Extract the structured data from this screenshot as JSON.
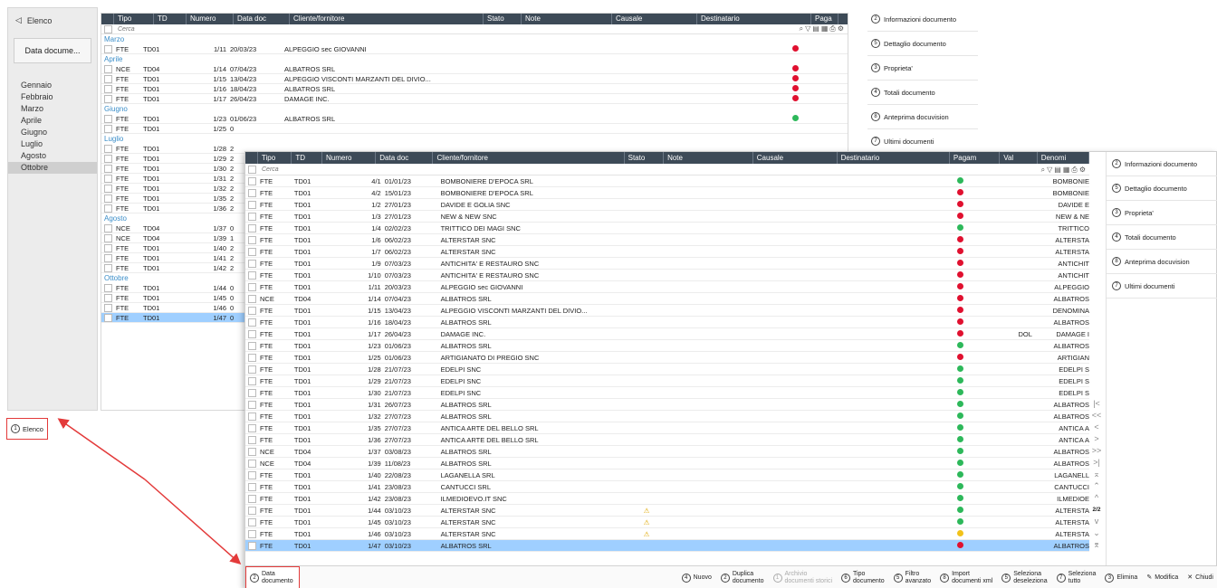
{
  "back": {
    "sidebar": {
      "elenco_label": "Elenco",
      "data_doc_button": "Data docume...",
      "months": [
        "Gennaio",
        "Febbraio",
        "Marzo",
        "Aprile",
        "Giugno",
        "Luglio",
        "Agosto",
        "Ottobre"
      ],
      "selected_month": "Ottobre"
    },
    "columns": [
      "Tipo",
      "TD",
      "Numero",
      "Data doc",
      "Cliente/fornitore",
      "Stato",
      "Note",
      "Causale",
      "Destinatario",
      "Paga"
    ],
    "search_placeholder": "Cerca",
    "groups": [
      {
        "name": "Marzo",
        "rows": [
          {
            "tipo": "FTE",
            "td": "TD01",
            "num": "1/11",
            "data": "20/03/23",
            "cliente": "ALPEGGIO sec GIOVANNI",
            "pag": "red"
          }
        ]
      },
      {
        "name": "Aprile",
        "rows": [
          {
            "tipo": "NCE",
            "td": "TD04",
            "num": "1/14",
            "data": "07/04/23",
            "cliente": "ALBATROS SRL",
            "pag": "red"
          },
          {
            "tipo": "FTE",
            "td": "TD01",
            "num": "1/15",
            "data": "13/04/23",
            "cliente": "ALPEGGIO VISCONTI MARZANTI DEL DIVIO...",
            "pag": "red"
          },
          {
            "tipo": "FTE",
            "td": "TD01",
            "num": "1/16",
            "data": "18/04/23",
            "cliente": "ALBATROS SRL",
            "pag": "red"
          },
          {
            "tipo": "FTE",
            "td": "TD01",
            "num": "1/17",
            "data": "26/04/23",
            "cliente": "DAMAGE INC.",
            "pag": "red"
          }
        ]
      },
      {
        "name": "Giugno",
        "rows": [
          {
            "tipo": "FTE",
            "td": "TD01",
            "num": "1/23",
            "data": "01/06/23",
            "cliente": "ALBATROS SRL",
            "pag": "green"
          },
          {
            "tipo": "FTE",
            "td": "TD01",
            "num": "1/25",
            "data": "0",
            "cliente": "",
            "pag": ""
          }
        ]
      },
      {
        "name": "Luglio",
        "rows": [
          {
            "tipo": "FTE",
            "td": "TD01",
            "num": "1/28",
            "data": "2",
            "cliente": "",
            "pag": ""
          },
          {
            "tipo": "FTE",
            "td": "TD01",
            "num": "1/29",
            "data": "2",
            "cliente": "",
            "pag": ""
          },
          {
            "tipo": "FTE",
            "td": "TD01",
            "num": "1/30",
            "data": "2",
            "cliente": "",
            "pag": ""
          },
          {
            "tipo": "FTE",
            "td": "TD01",
            "num": "1/31",
            "data": "2",
            "cliente": "",
            "pag": ""
          },
          {
            "tipo": "FTE",
            "td": "TD01",
            "num": "1/32",
            "data": "2",
            "cliente": "",
            "pag": ""
          },
          {
            "tipo": "FTE",
            "td": "TD01",
            "num": "1/35",
            "data": "2",
            "cliente": "",
            "pag": ""
          },
          {
            "tipo": "FTE",
            "td": "TD01",
            "num": "1/36",
            "data": "2",
            "cliente": "",
            "pag": ""
          }
        ]
      },
      {
        "name": "Agosto",
        "rows": [
          {
            "tipo": "NCE",
            "td": "TD04",
            "num": "1/37",
            "data": "0",
            "cliente": "",
            "pag": ""
          },
          {
            "tipo": "NCE",
            "td": "TD04",
            "num": "1/39",
            "data": "1",
            "cliente": "",
            "pag": ""
          },
          {
            "tipo": "FTE",
            "td": "TD01",
            "num": "1/40",
            "data": "2",
            "cliente": "",
            "pag": ""
          },
          {
            "tipo": "FTE",
            "td": "TD01",
            "num": "1/41",
            "data": "2",
            "cliente": "",
            "pag": ""
          },
          {
            "tipo": "FTE",
            "td": "TD01",
            "num": "1/42",
            "data": "2",
            "cliente": "",
            "pag": ""
          }
        ]
      },
      {
        "name": "Ottobre",
        "rows": [
          {
            "tipo": "FTE",
            "td": "TD01",
            "num": "1/44",
            "data": "0",
            "cliente": "",
            "pag": ""
          },
          {
            "tipo": "FTE",
            "td": "TD01",
            "num": "1/45",
            "data": "0",
            "cliente": "",
            "pag": ""
          },
          {
            "tipo": "FTE",
            "td": "TD01",
            "num": "1/46",
            "data": "0",
            "cliente": "",
            "pag": ""
          },
          {
            "tipo": "FTE",
            "td": "TD01",
            "num": "1/47",
            "data": "0",
            "cliente": "",
            "pag": "",
            "selected": true
          }
        ]
      }
    ],
    "right_panel": [
      "Informazioni documento",
      "Dettaglio documento",
      "Proprieta'",
      "Totali documento",
      "Anteprima docuvision",
      "Ultimi documenti"
    ],
    "right_panel_keys": [
      "2",
      "5",
      "3",
      "4",
      "8",
      "7"
    ]
  },
  "callout_elenco": {
    "key": "1",
    "label": "Elenco"
  },
  "front": {
    "columns": [
      "Tipo",
      "TD",
      "Numero",
      "Data doc",
      "Cliente/fornitore",
      "Stato",
      "Note",
      "Causale",
      "Destinatario",
      "Pagam",
      "Val",
      "Denomi"
    ],
    "search_placeholder": "Cerca",
    "rows": [
      {
        "tipo": "FTE",
        "td": "TD01",
        "num": "4/1",
        "data": "01/01/23",
        "cliente": "BOMBONIERE D'EPOCA SRL",
        "stato": "",
        "pag": "green",
        "val": "",
        "den": "BOMBONIE"
      },
      {
        "tipo": "FTE",
        "td": "TD01",
        "num": "4/2",
        "data": "15/01/23",
        "cliente": "BOMBONIERE D'EPOCA SRL",
        "stato": "",
        "pag": "red",
        "val": "",
        "den": "BOMBONIE"
      },
      {
        "tipo": "FTE",
        "td": "TD01",
        "num": "1/2",
        "data": "27/01/23",
        "cliente": "DAVIDE E GOLIA SNC",
        "stato": "",
        "pag": "red",
        "val": "",
        "den": "DAVIDE E"
      },
      {
        "tipo": "FTE",
        "td": "TD01",
        "num": "1/3",
        "data": "27/01/23",
        "cliente": "NEW & NEW SNC",
        "stato": "",
        "pag": "red",
        "val": "",
        "den": "NEW & NE"
      },
      {
        "tipo": "FTE",
        "td": "TD01",
        "num": "1/4",
        "data": "02/02/23",
        "cliente": "TRITTICO DEI MAGI SNC",
        "stato": "",
        "pag": "green",
        "val": "",
        "den": "TRITTICO"
      },
      {
        "tipo": "FTE",
        "td": "TD01",
        "num": "1/6",
        "data": "06/02/23",
        "cliente": "ALTERSTAR SNC",
        "stato": "",
        "pag": "red",
        "val": "",
        "den": "ALTERSTA"
      },
      {
        "tipo": "FTE",
        "td": "TD01",
        "num": "1/7",
        "data": "06/02/23",
        "cliente": "ALTERSTAR SNC",
        "stato": "",
        "pag": "red",
        "val": "",
        "den": "ALTERSTA"
      },
      {
        "tipo": "FTE",
        "td": "TD01",
        "num": "1/9",
        "data": "07/03/23",
        "cliente": "ANTICHITA' E RESTAURO SNC",
        "stato": "",
        "pag": "red",
        "val": "",
        "den": "ANTICHIT"
      },
      {
        "tipo": "FTE",
        "td": "TD01",
        "num": "1/10",
        "data": "07/03/23",
        "cliente": "ANTICHITA' E RESTAURO SNC",
        "stato": "",
        "pag": "red",
        "val": "",
        "den": "ANTICHIT"
      },
      {
        "tipo": "FTE",
        "td": "TD01",
        "num": "1/11",
        "data": "20/03/23",
        "cliente": "ALPEGGIO sec GIOVANNI",
        "stato": "",
        "pag": "red",
        "val": "",
        "den": "ALPEGGIO"
      },
      {
        "tipo": "NCE",
        "td": "TD04",
        "num": "1/14",
        "data": "07/04/23",
        "cliente": "ALBATROS SRL",
        "stato": "",
        "pag": "red",
        "val": "",
        "den": "ALBATROS"
      },
      {
        "tipo": "FTE",
        "td": "TD01",
        "num": "1/15",
        "data": "13/04/23",
        "cliente": "ALPEGGIO VISCONTI MARZANTI DEL DIVIO...",
        "stato": "",
        "pag": "red",
        "val": "",
        "den": "DENOMINA"
      },
      {
        "tipo": "FTE",
        "td": "TD01",
        "num": "1/16",
        "data": "18/04/23",
        "cliente": "ALBATROS SRL",
        "stato": "",
        "pag": "red",
        "val": "",
        "den": "ALBATROS"
      },
      {
        "tipo": "FTE",
        "td": "TD01",
        "num": "1/17",
        "data": "26/04/23",
        "cliente": "DAMAGE INC.",
        "stato": "",
        "pag": "red",
        "val": "DOL",
        "den": "DAMAGE I"
      },
      {
        "tipo": "FTE",
        "td": "TD01",
        "num": "1/23",
        "data": "01/06/23",
        "cliente": "ALBATROS SRL",
        "stato": "",
        "pag": "green",
        "val": "",
        "den": "ALBATROS"
      },
      {
        "tipo": "FTE",
        "td": "TD01",
        "num": "1/25",
        "data": "01/06/23",
        "cliente": "ARTIGIANATO DI PREGIO SNC",
        "stato": "",
        "pag": "red",
        "val": "",
        "den": "ARTIGIAN"
      },
      {
        "tipo": "FTE",
        "td": "TD01",
        "num": "1/28",
        "data": "21/07/23",
        "cliente": "EDELPI SNC",
        "stato": "",
        "pag": "green",
        "val": "",
        "den": "EDELPI S"
      },
      {
        "tipo": "FTE",
        "td": "TD01",
        "num": "1/29",
        "data": "21/07/23",
        "cliente": "EDELPI SNC",
        "stato": "",
        "pag": "green",
        "val": "",
        "den": "EDELPI S"
      },
      {
        "tipo": "FTE",
        "td": "TD01",
        "num": "1/30",
        "data": "21/07/23",
        "cliente": "EDELPI SNC",
        "stato": "",
        "pag": "green",
        "val": "",
        "den": "EDELPI S"
      },
      {
        "tipo": "FTE",
        "td": "TD01",
        "num": "1/31",
        "data": "26/07/23",
        "cliente": "ALBATROS SRL",
        "stato": "",
        "pag": "green",
        "val": "",
        "den": "ALBATROS"
      },
      {
        "tipo": "FTE",
        "td": "TD01",
        "num": "1/32",
        "data": "27/07/23",
        "cliente": "ALBATROS SRL",
        "stato": "",
        "pag": "green",
        "val": "",
        "den": "ALBATROS"
      },
      {
        "tipo": "FTE",
        "td": "TD01",
        "num": "1/35",
        "data": "27/07/23",
        "cliente": "ANTICA ARTE DEL BELLO SRL",
        "stato": "",
        "pag": "green",
        "val": "",
        "den": "ANTICA A"
      },
      {
        "tipo": "FTE",
        "td": "TD01",
        "num": "1/36",
        "data": "27/07/23",
        "cliente": "ANTICA ARTE DEL BELLO SRL",
        "stato": "",
        "pag": "green",
        "val": "",
        "den": "ANTICA A"
      },
      {
        "tipo": "NCE",
        "td": "TD04",
        "num": "1/37",
        "data": "03/08/23",
        "cliente": "ALBATROS SRL",
        "stato": "",
        "pag": "green",
        "val": "",
        "den": "ALBATROS"
      },
      {
        "tipo": "NCE",
        "td": "TD04",
        "num": "1/39",
        "data": "11/08/23",
        "cliente": "ALBATROS SRL",
        "stato": "",
        "pag": "green",
        "val": "",
        "den": "ALBATROS"
      },
      {
        "tipo": "FTE",
        "td": "TD01",
        "num": "1/40",
        "data": "22/08/23",
        "cliente": "LAGANELLA SRL",
        "stato": "",
        "pag": "green",
        "val": "",
        "den": "LAGANELL"
      },
      {
        "tipo": "FTE",
        "td": "TD01",
        "num": "1/41",
        "data": "23/08/23",
        "cliente": "CANTUCCI SRL",
        "stato": "",
        "pag": "green",
        "val": "",
        "den": "CANTUCCI"
      },
      {
        "tipo": "FTE",
        "td": "TD01",
        "num": "1/42",
        "data": "23/08/23",
        "cliente": "ILMEDIOEVO.IT SNC",
        "stato": "",
        "pag": "green",
        "val": "",
        "den": "ILMEDIOE"
      },
      {
        "tipo": "FTE",
        "td": "TD01",
        "num": "1/44",
        "data": "03/10/23",
        "cliente": "ALTERSTAR SNC",
        "stato": "⚠",
        "pag": "green",
        "val": "",
        "den": "ALTERSTA"
      },
      {
        "tipo": "FTE",
        "td": "TD01",
        "num": "1/45",
        "data": "03/10/23",
        "cliente": "ALTERSTAR SNC",
        "stato": "⚠",
        "pag": "green",
        "val": "",
        "den": "ALTERSTA"
      },
      {
        "tipo": "FTE",
        "td": "TD01",
        "num": "1/46",
        "data": "03/10/23",
        "cliente": "ALTERSTAR SNC",
        "stato": "⚠",
        "pag": "yellow",
        "val": "",
        "den": "ALTERSTA"
      },
      {
        "tipo": "FTE",
        "td": "TD01",
        "num": "1/47",
        "data": "03/10/23",
        "cliente": "ALBATROS SRL",
        "stato": "",
        "pag": "red",
        "val": "",
        "den": "ALBATROS",
        "selected": true
      }
    ],
    "nav": [
      "|<",
      "<<",
      "<",
      ">",
      ">>",
      ">|",
      "⌅",
      "⌃",
      "^",
      "2/2",
      "v",
      "⌄",
      "⌆"
    ],
    "right_panel": [
      "Informazioni documento",
      "Dettaglio documento",
      "Proprieta'",
      "Totali documento",
      "Anteprima docuvision",
      "Ultimi documenti"
    ],
    "right_panel_keys": [
      "2",
      "5",
      "3",
      "4",
      "8",
      "7"
    ],
    "toolbar": [
      {
        "key": "2",
        "label": "Data documento",
        "icon": "calendar"
      },
      {
        "key": "4",
        "label": "Nuovo"
      },
      {
        "key": "2",
        "label": "Duplica documento"
      },
      {
        "key": "1",
        "label": "Archivio documenti storici",
        "disabled": true
      },
      {
        "key": "6",
        "label": "Tipo documento"
      },
      {
        "key": "5",
        "label": "Filtro avanzato"
      },
      {
        "key": "8",
        "label": "Import documenti xml"
      },
      {
        "key": "5",
        "label": "Seleziona deseleziona"
      },
      {
        "key": "7",
        "label": "Seleziona tutto"
      },
      {
        "key": "3",
        "label": "Elimina"
      },
      {
        "key": "",
        "label": "Modifica",
        "icon": "pencil"
      },
      {
        "key": "",
        "label": "Chiudi",
        "icon": "x"
      }
    ]
  },
  "colors": {
    "header_bg": "#3d4a57",
    "selected_row": "#9fcfff",
    "group_text": "#3b8ec9",
    "callout": "#e33a3a",
    "red": "#e0102f",
    "green": "#2db85a",
    "yellow": "#f2c21a"
  }
}
